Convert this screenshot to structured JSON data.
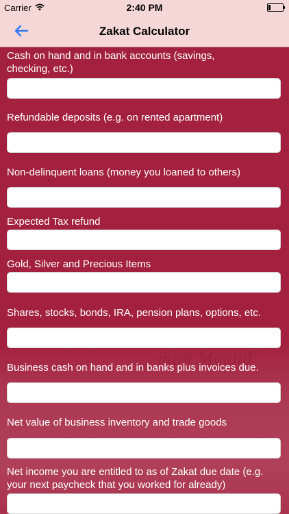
{
  "status_bar": {
    "carrier": "Carrier",
    "time": "2:40 PM"
  },
  "nav": {
    "title": "Zakat Calculator",
    "back_icon": "arrow-left-icon"
  },
  "background_sign": "man Masjid",
  "colors": {
    "background": "#a3213f",
    "nav_background": "#f6d7d8",
    "accent": "#2f7cf6"
  },
  "fields": [
    {
      "label": "Cash on hand and in bank accounts (savings, checking, etc.)",
      "value": "",
      "placeholder": ""
    },
    {
      "label": "Refundable deposits (e.g. on rented apartment)",
      "value": "",
      "placeholder": ""
    },
    {
      "label": "Non-delinquent loans (money you loaned to others)",
      "value": "",
      "placeholder": ""
    },
    {
      "label": "Expected Tax refund",
      "value": "",
      "placeholder": ""
    },
    {
      "label": "Gold, Silver and Precious Items",
      "value": "",
      "placeholder": ""
    },
    {
      "label": "Shares, stocks, bonds, IRA, pension plans, options, etc.",
      "value": "",
      "placeholder": ""
    },
    {
      "label": "Business cash on hand and in banks plus invoices due.",
      "value": "",
      "placeholder": ""
    },
    {
      "label": "Net value of business inventory and trade goods",
      "value": "",
      "placeholder": ""
    },
    {
      "label": "Net income you are entitled to as of Zakat due date (e.g. your next paycheck that you worked for already)",
      "value": "",
      "placeholder": ""
    }
  ]
}
